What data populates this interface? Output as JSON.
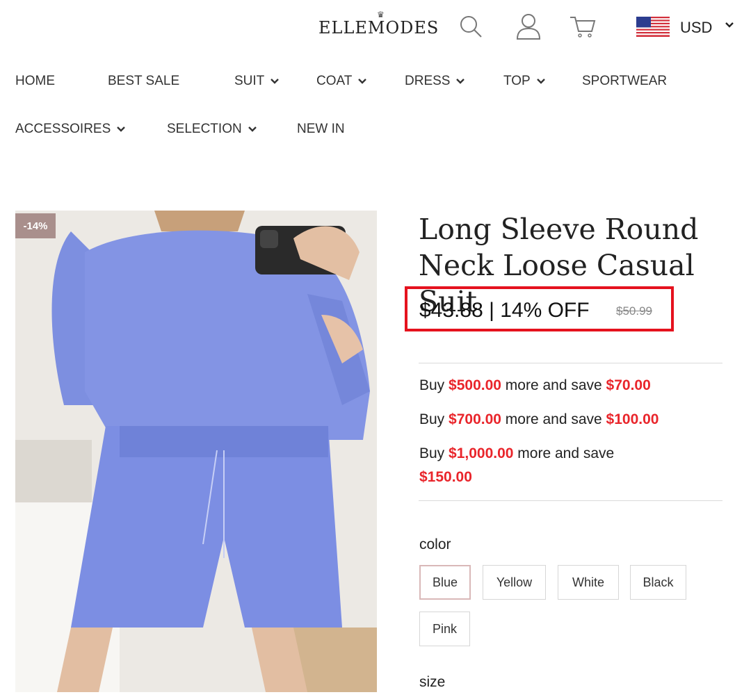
{
  "header": {
    "logo": "ELLEMODES",
    "currency": "USD",
    "icons": [
      "search-icon",
      "user-icon",
      "cart-icon",
      "us-flag-icon"
    ]
  },
  "nav": {
    "items": [
      {
        "label": "HOME",
        "dropdown": false
      },
      {
        "label": "BEST SALE",
        "dropdown": false
      },
      {
        "label": "SUIT",
        "dropdown": true
      },
      {
        "label": "COAT",
        "dropdown": true
      },
      {
        "label": "DRESS",
        "dropdown": true
      },
      {
        "label": "TOP",
        "dropdown": true
      },
      {
        "label": "SPORTWEAR",
        "dropdown": false
      },
      {
        "label": "ACCESSOIRES",
        "dropdown": true
      },
      {
        "label": "SELECTION",
        "dropdown": true
      },
      {
        "label": "NEW IN",
        "dropdown": false
      }
    ]
  },
  "product": {
    "badge": "-14%",
    "title": "Long Sleeve Round Neck Loose Casual Suit",
    "price_line": "$43.88 | 14% OFF",
    "original_price": "$50.99",
    "deals": [
      {
        "pre": "Buy ",
        "amount": "$500.00",
        "mid": " more and save ",
        "save": "$70.00"
      },
      {
        "pre": "Buy ",
        "amount": "$700.00",
        "mid": " more and save ",
        "save": "$100.00"
      },
      {
        "pre": "Buy ",
        "amount": "$1,000.00",
        "mid": " more and save ",
        "save": "$150.00"
      }
    ],
    "color_label": "color",
    "colors": [
      "Blue",
      "Yellow",
      "White",
      "Black",
      "Pink"
    ],
    "selected_color": "Blue",
    "size_label": "size"
  },
  "colors": {
    "accent_red": "#e9252b",
    "highlight_box": "#e5121e",
    "badge": "#a98f8c",
    "product_blue": "#7b8fe0"
  }
}
